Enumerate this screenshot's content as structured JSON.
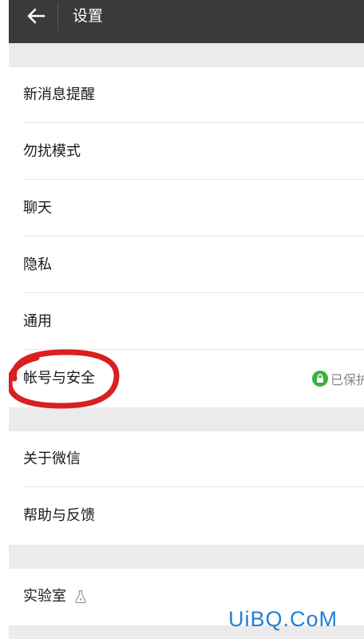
{
  "header": {
    "title": "设置",
    "back_icon": "arrow-left-icon",
    "background": "#3a3a3c"
  },
  "settings": {
    "group1": [
      {
        "label": "新消息提醒"
      },
      {
        "label": "勿扰模式"
      },
      {
        "label": "聊天"
      },
      {
        "label": "隐私"
      },
      {
        "label": "通用"
      },
      {
        "label": "帐号与安全",
        "status": "已保护",
        "status_icon": "lock-icon",
        "status_color": "#3cb043"
      }
    ],
    "group2": [
      {
        "label": "关于微信"
      },
      {
        "label": "帮助与反馈"
      }
    ],
    "group3": [
      {
        "label": "实验室",
        "icon": "flask-icon"
      }
    ]
  },
  "annotation": {
    "highlight_color": "#d92020"
  },
  "watermark": {
    "text": "UiBQ.CoM",
    "color": "#1e7fd6"
  }
}
